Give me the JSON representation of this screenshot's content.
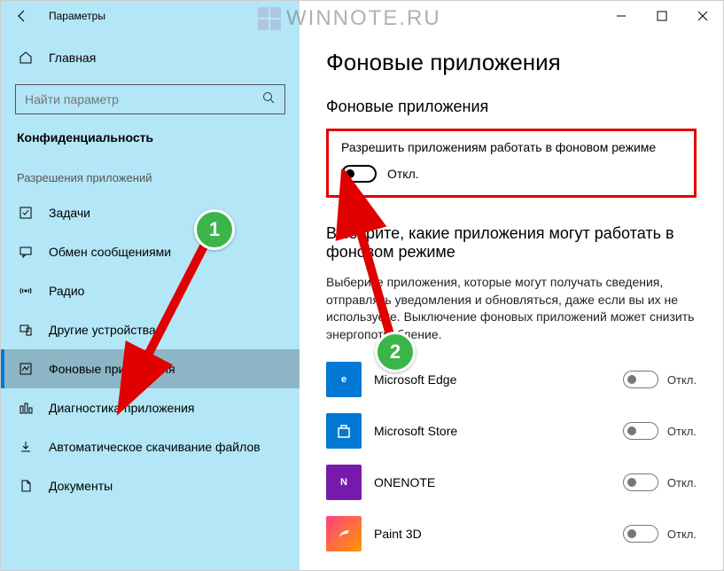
{
  "window": {
    "title": "Параметры"
  },
  "watermark": "WINNOTE.RU",
  "sidebar": {
    "home": "Главная",
    "search_placeholder": "Найти параметр",
    "section": "Конфиденциальность",
    "group": "Разрешения приложений",
    "items": [
      {
        "label": "Задачи"
      },
      {
        "label": "Обмен сообщениями"
      },
      {
        "label": "Радио"
      },
      {
        "label": "Другие устройства"
      },
      {
        "label": "Фоновые приложения",
        "selected": true
      },
      {
        "label": "Диагностика приложения"
      },
      {
        "label": "Автоматическое скачивание файлов"
      },
      {
        "label": "Документы"
      }
    ]
  },
  "main": {
    "title": "Фоновые приложения",
    "sub1": "Фоновые приложения",
    "master_label": "Разрешить приложениям работать в фоновом режиме",
    "master_state": "Откл.",
    "sub2": "Выберите, какие приложения могут работать в фоновом режиме",
    "desc": "Выберите приложения, которые могут получать сведения, отправлять уведомления и обновляться, даже если вы их не используете. Выключение фоновых приложений может снизить энергопотребление.",
    "apps": [
      {
        "name": "Microsoft Edge",
        "state": "Откл.",
        "color": "#0078d4",
        "glyph": "e"
      },
      {
        "name": "Microsoft Store",
        "state": "Откл.",
        "color": "#0078d4",
        "glyph": "⊞"
      },
      {
        "name": "ONENOTE",
        "state": "Откл.",
        "color": "#7719aa",
        "glyph": "N"
      },
      {
        "name": "Paint 3D",
        "state": "Откл.",
        "color": "#ff4081",
        "glyph": "🎨"
      }
    ]
  },
  "badges": {
    "one": "1",
    "two": "2"
  }
}
